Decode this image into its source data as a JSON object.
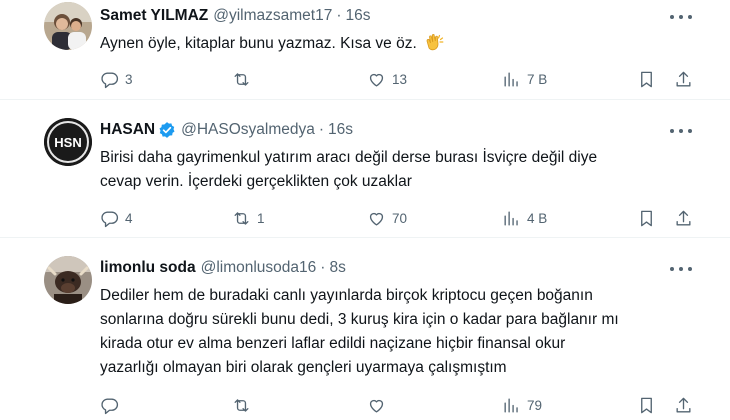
{
  "tweets": [
    {
      "name": "Samet YILMAZ",
      "handle": "@yilmazsamet17",
      "dot": "·",
      "time": "16s",
      "verified": false,
      "lines": [
        "Aynen öyle, kitaplar bunu yazmaz. Kısa ve öz."
      ],
      "emoji": "clapping-hands",
      "replies": "3",
      "retweets": "",
      "likes": "13",
      "views": "7 B"
    },
    {
      "name": "HASAN",
      "handle": "@HASOsyalmedya",
      "dot": "·",
      "time": "16s",
      "verified": true,
      "avatar_text": "HSN",
      "lines": [
        "Birisi daha gayrimenkul yatırım aracı değil derse burası İsviçre değil diye",
        "cevap verin. İçerdeki gerçeklikten çok uzaklar"
      ],
      "replies": "4",
      "retweets": "1",
      "likes": "70",
      "views": "4 B"
    },
    {
      "name": "limonlu soda",
      "handle": "@limonlusoda16",
      "dot": "·",
      "time": "8s",
      "verified": false,
      "lines": [
        "Dediler hem de buradaki canlı yayınlarda birçok kriptocu geçen boğanın",
        "sonlarına doğru sürekli bunu dedi, 3 kuruş kira için o kadar para bağlanır mı",
        "kirada otur ev alma benzeri laflar edildi naçizane hiçbir finansal okur",
        "yazarlığı olmayan biri olarak gençleri uyarmaya çalışmıştım"
      ],
      "replies": "",
      "retweets": "",
      "likes": "",
      "views": "79"
    }
  ],
  "colors": {
    "text": "#0f1419",
    "muted": "#536471",
    "verified": "#1d9bf0",
    "divider": "#eff3f4"
  },
  "icons": [
    "reply-icon",
    "retweet-icon",
    "like-icon",
    "views-icon",
    "bookmark-icon",
    "share-icon",
    "more-icon",
    "verified-badge-icon"
  ]
}
